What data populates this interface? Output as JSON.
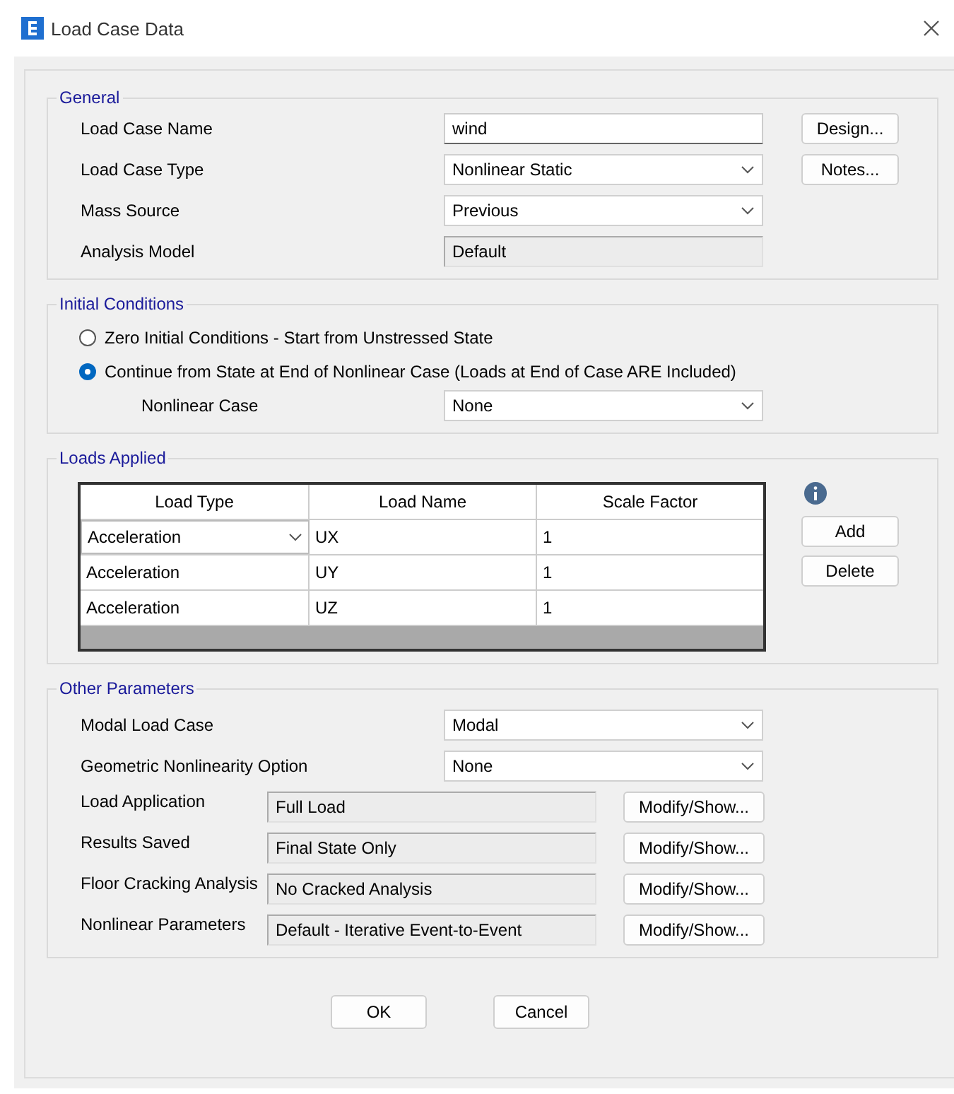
{
  "window": {
    "title": "Load Case Data"
  },
  "general": {
    "title": "General",
    "rows": [
      {
        "label": "Load Case Name",
        "kind": "text",
        "value": "wind"
      },
      {
        "label": "Load Case Type",
        "kind": "dropdown",
        "value": "Nonlinear Static"
      },
      {
        "label": "Mass Source",
        "kind": "dropdown",
        "value": "Previous"
      },
      {
        "label": "Analysis Model",
        "kind": "readonly",
        "value": "Default"
      }
    ],
    "buttons": [
      "Design...",
      "Notes..."
    ]
  },
  "initial_conditions": {
    "title": "Initial Conditions",
    "options": [
      {
        "label": "Zero Initial Conditions - Start from Unstressed State",
        "selected": false
      },
      {
        "label": "Continue from State at End of Nonlinear Case  (Loads at End of Case ARE Included)",
        "selected": true
      }
    ],
    "nonlinear_case": {
      "label": "Nonlinear Case",
      "value": "None"
    }
  },
  "loads_applied": {
    "title": "Loads Applied",
    "columns": [
      "Load Type",
      "Load Name",
      "Scale Factor"
    ],
    "rows": [
      {
        "load_type": "Acceleration",
        "load_name": "UX",
        "scale_factor": "1",
        "editing": true
      },
      {
        "load_type": "Acceleration",
        "load_name": "UY",
        "scale_factor": "1",
        "editing": false
      },
      {
        "load_type": "Acceleration",
        "load_name": "UZ",
        "scale_factor": "1",
        "editing": false
      }
    ],
    "buttons": [
      "Add",
      "Delete"
    ]
  },
  "other_parameters": {
    "title": "Other Parameters",
    "dropdowns": [
      {
        "label": "Modal Load Case",
        "value": "Modal"
      },
      {
        "label": "Geometric Nonlinearity Option",
        "value": "None"
      }
    ],
    "settings": [
      {
        "label": "Load Application",
        "value": "Full Load",
        "button": "Modify/Show..."
      },
      {
        "label": "Results Saved",
        "value": "Final State Only",
        "button": "Modify/Show..."
      },
      {
        "label": "Floor Cracking Analysis",
        "value": "No Cracked Analysis",
        "button": "Modify/Show..."
      },
      {
        "label": "Nonlinear Parameters",
        "value": "Default - Iterative Event-to-Event",
        "button": "Modify/Show..."
      }
    ]
  },
  "buttons": [
    "OK",
    "Cancel"
  ]
}
